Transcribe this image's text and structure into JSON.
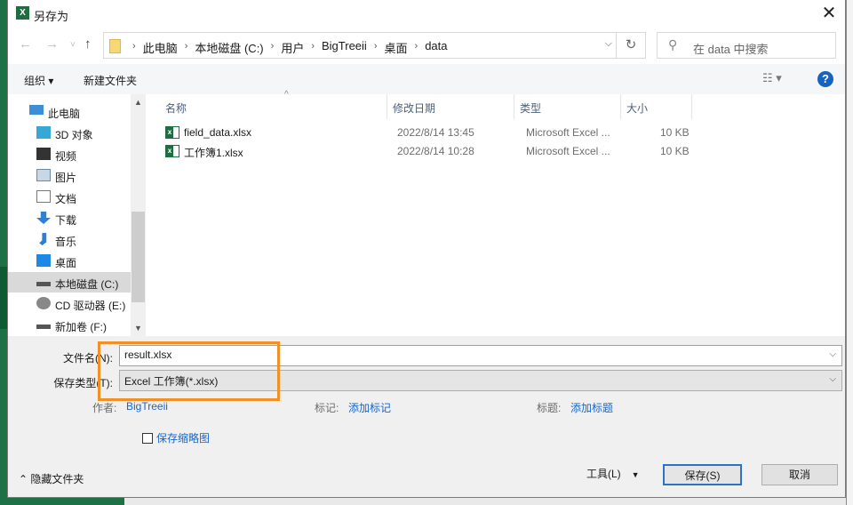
{
  "window": {
    "title": "另存为",
    "app_icon": "X",
    "close": "✕"
  },
  "nav": {
    "back": "←",
    "forward": "→",
    "recent": "˅",
    "up": "↑",
    "refresh": "↻",
    "breadcrumb": [
      "此电脑",
      "本地磁盘 (C:)",
      "用户",
      "BigTreeii",
      "桌面",
      "data"
    ],
    "search_placeholder": "在 data 中搜索"
  },
  "toolbar": {
    "organize": "组织 ▾",
    "new_folder": "新建文件夹",
    "view": "☷ ▾",
    "help": "?"
  },
  "sidebar": {
    "items": [
      {
        "label": "此电脑",
        "icon": "computer-icon"
      },
      {
        "label": "3D 对象",
        "icon": "cube-icon"
      },
      {
        "label": "视频",
        "icon": "video-icon"
      },
      {
        "label": "图片",
        "icon": "picture-icon"
      },
      {
        "label": "文档",
        "icon": "document-icon"
      },
      {
        "label": "下载",
        "icon": "download-icon"
      },
      {
        "label": "音乐",
        "icon": "music-icon"
      },
      {
        "label": "桌面",
        "icon": "desktop-icon"
      },
      {
        "label": "本地磁盘 (C:)",
        "icon": "drive-icon",
        "selected": true
      },
      {
        "label": "CD 驱动器 (E:)",
        "icon": "cd-drive-icon"
      },
      {
        "label": "新加卷 (F:)",
        "icon": "drive-icon"
      }
    ]
  },
  "columns": [
    "名称",
    "修改日期",
    "类型",
    "大小"
  ],
  "files": [
    {
      "name": "field_data.xlsx",
      "date": "2022/8/14 13:45",
      "type": "Microsoft Excel ...",
      "size": "10 KB"
    },
    {
      "name": "工作簿1.xlsx",
      "date": "2022/8/14 10:28",
      "type": "Microsoft Excel ...",
      "size": "10 KB"
    }
  ],
  "form": {
    "filename_label": "文件名(N):",
    "filename": "result.xlsx",
    "type_label": "保存类型(T):",
    "type_value": "Excel 工作簿(*.xlsx)",
    "author_label": "作者:",
    "author": "BigTreeii",
    "tags_label": "标记:",
    "tags": "添加标记",
    "title_label": "标题:",
    "title": "添加标题",
    "thumbnail": "保存缩略图"
  },
  "footer": {
    "hide_folders": "隐藏文件夹",
    "tools": "工具(L)",
    "save": "保存(S)",
    "cancel": "取消"
  },
  "colors": {
    "highlight": "#f39025",
    "link": "#1a66c9",
    "excel": "#1d6f42"
  }
}
